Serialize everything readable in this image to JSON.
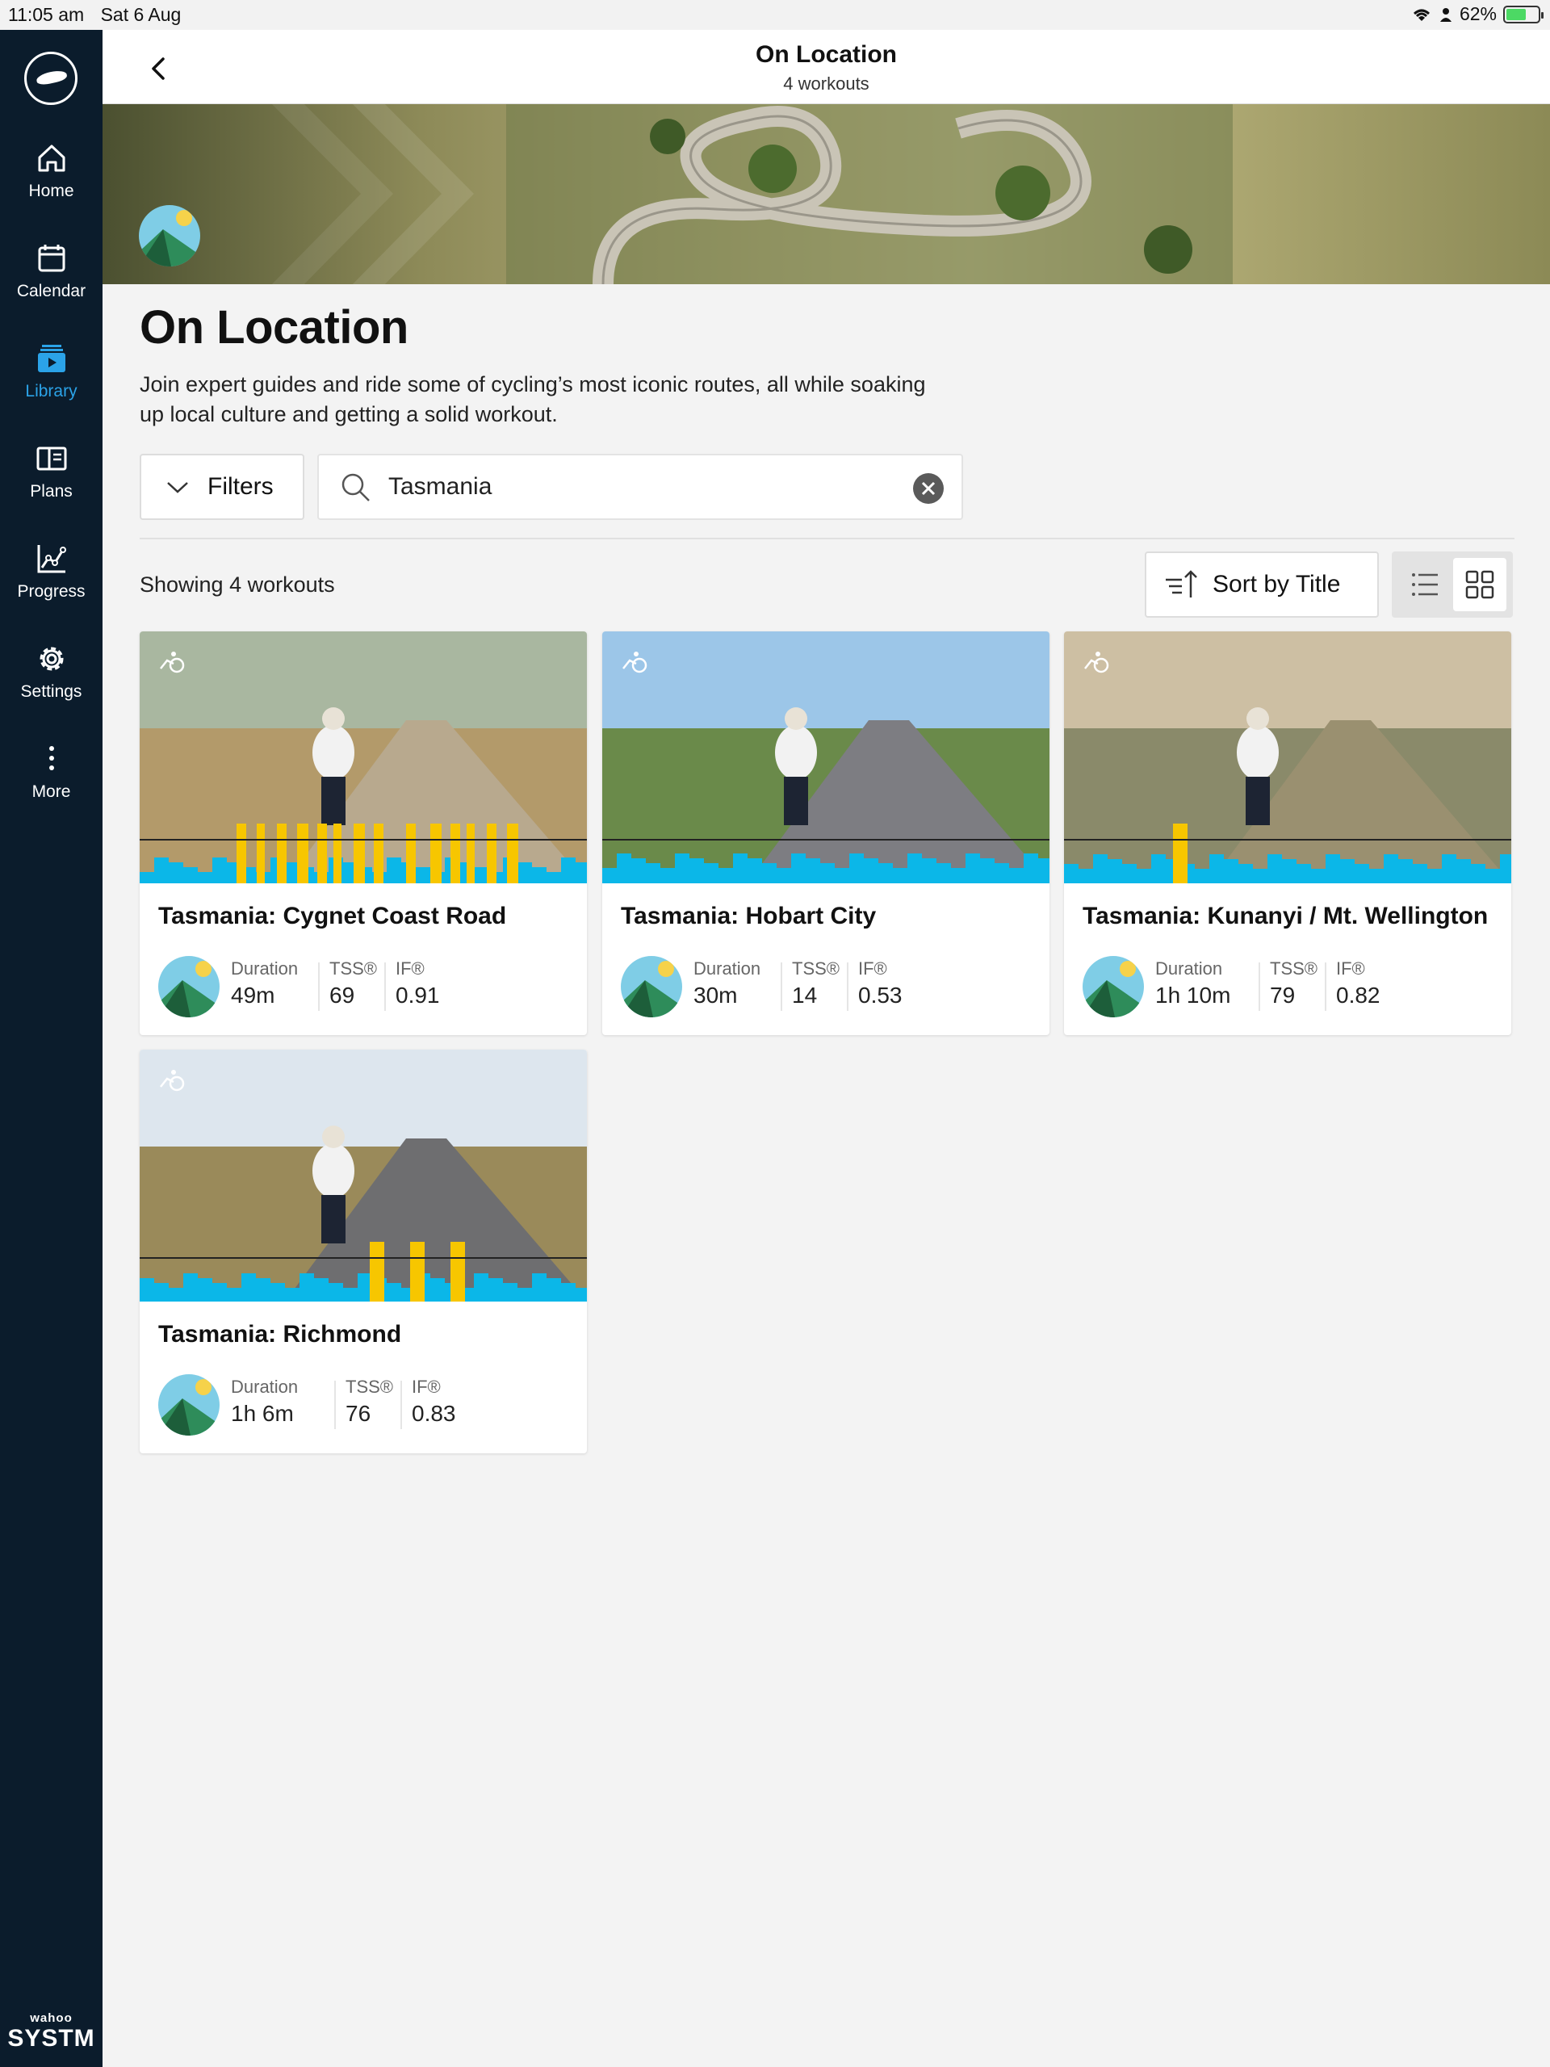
{
  "status_bar": {
    "time": "11:05 am",
    "date": "Sat 6 Aug",
    "battery": "62%",
    "battery_level": 0.62
  },
  "sidebar": {
    "items": [
      {
        "label": "Home",
        "icon": "home-icon"
      },
      {
        "label": "Calendar",
        "icon": "calendar-icon"
      },
      {
        "label": "Library",
        "icon": "library-icon",
        "active": true
      },
      {
        "label": "Plans",
        "icon": "plans-icon"
      },
      {
        "label": "Progress",
        "icon": "progress-icon"
      },
      {
        "label": "Settings",
        "icon": "gear-icon"
      },
      {
        "label": "More",
        "icon": "more-dots-icon"
      }
    ],
    "brand_small": "wahoo",
    "brand_big": "SYSTM"
  },
  "header": {
    "title": "On Location",
    "subtitle": "4 workouts"
  },
  "page": {
    "title": "On Location",
    "description": "Join expert guides and ride some of cycling’s most iconic routes, all while soaking up local culture and getting a solid workout."
  },
  "filters": {
    "label": "Filters"
  },
  "search": {
    "value": "Tasmania"
  },
  "results": {
    "showing": "Showing 4 workouts"
  },
  "sort": {
    "label": "Sort by Title"
  },
  "stat_labels": {
    "duration": "Duration",
    "tss": "TSS®",
    "if": "IF®"
  },
  "colors": {
    "accent": "#2ba3e8",
    "sidebar": "#0b1c2c",
    "profile_blue": "#0bb7e8",
    "profile_yellow": "#f7c600"
  },
  "workouts": [
    {
      "title": "Tasmania: Cygnet Coast Road",
      "duration": "49m",
      "tss": "69",
      "if": "0.91"
    },
    {
      "title": "Tasmania: Hobart City",
      "duration": "30m",
      "tss": "14",
      "if": "0.53"
    },
    {
      "title": "Tasmania: Kunanyi / Mt. Wellington",
      "duration": "1h 10m",
      "tss": "79",
      "if": "0.82"
    },
    {
      "title": "Tasmania: Richmond",
      "duration": "1h 6m",
      "tss": "76",
      "if": "0.83"
    }
  ]
}
